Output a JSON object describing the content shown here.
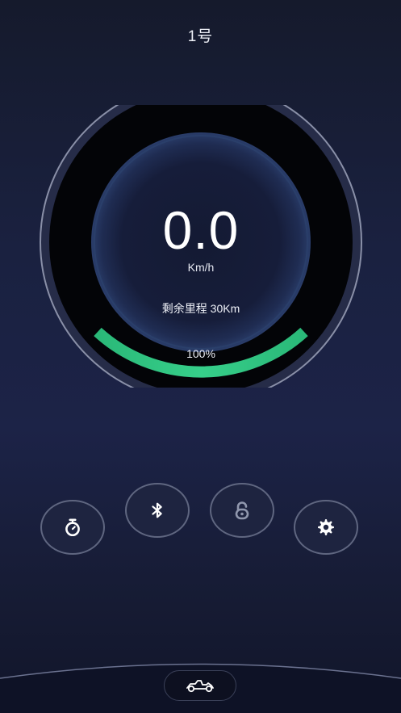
{
  "header": {
    "title": "1号"
  },
  "dashboard": {
    "speed": "0.0",
    "speed_unit": "Km/h",
    "remaining_range": "剩余里程 30Km",
    "battery_label": "100%",
    "battery_level": 1.0
  },
  "controls": [
    {
      "name": "timer-button",
      "icon": "stopwatch-icon"
    },
    {
      "name": "bluetooth-button",
      "icon": "bluetooth-icon"
    },
    {
      "name": "lock-button",
      "icon": "unlock-icon"
    },
    {
      "name": "settings-button",
      "icon": "gear-icon"
    }
  ],
  "bottom_nav": {
    "icon": "go-kart-icon"
  },
  "colors": {
    "accent": "#2fbf7f",
    "background": "#1a2140"
  }
}
